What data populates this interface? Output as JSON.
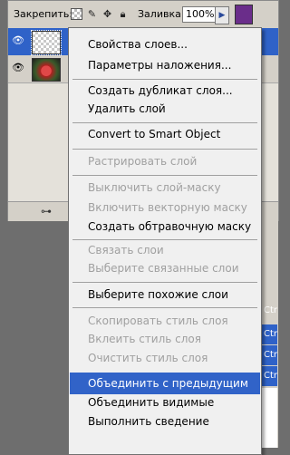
{
  "layers_panel": {
    "lock_label": "Закрепить:",
    "fill_label": "Заливка:",
    "fill_value": "100%",
    "lock_icons": [
      "lock-transparent-icon",
      "brush-icon",
      "move-icon",
      "lock-all-icon"
    ],
    "layers": [
      {
        "name": "empty-layer",
        "selected": true,
        "visible": true
      },
      {
        "name": "photo-layer",
        "selected": false,
        "visible": true
      }
    ]
  },
  "history_panel": {
    "shortcut_labels": [
      "Ctr",
      "Ctr",
      "Ctr",
      "Ctr"
    ]
  },
  "context_menu": {
    "items": [
      {
        "label": "Свойства слоев...",
        "enabled": true
      },
      {
        "label": "Параметры наложения...",
        "enabled": true
      },
      {
        "label": "Создать дубликат слоя...",
        "enabled": true
      },
      {
        "label": "Удалить слой",
        "enabled": true
      },
      {
        "label": "Convert to Smart Object",
        "enabled": true
      },
      {
        "label": "Растрировать слой",
        "enabled": false
      },
      {
        "label": "Выключить слой-маску",
        "enabled": false
      },
      {
        "label": "Включить векторную маску",
        "enabled": false
      },
      {
        "label": "Создать обтравочную маску",
        "enabled": true
      },
      {
        "label": "Связать слои",
        "enabled": false
      },
      {
        "label": "Выберите связанные слои",
        "enabled": false
      },
      {
        "label": "Выберите похожие слои",
        "enabled": true
      },
      {
        "label": "Скопировать стиль слоя",
        "enabled": false
      },
      {
        "label": "Вклеить стиль слоя",
        "enabled": false
      },
      {
        "label": "Очистить стиль слоя",
        "enabled": false
      },
      {
        "label": "Объединить с предыдущим",
        "enabled": true,
        "highlighted": true
      },
      {
        "label": "Объединить видимые",
        "enabled": true
      },
      {
        "label": "Выполнить сведение",
        "enabled": true
      }
    ]
  },
  "colors": {
    "selection_blue": "#3163c8",
    "menu_background": "#f0f0f0",
    "disabled_text": "#a0a0a0"
  }
}
